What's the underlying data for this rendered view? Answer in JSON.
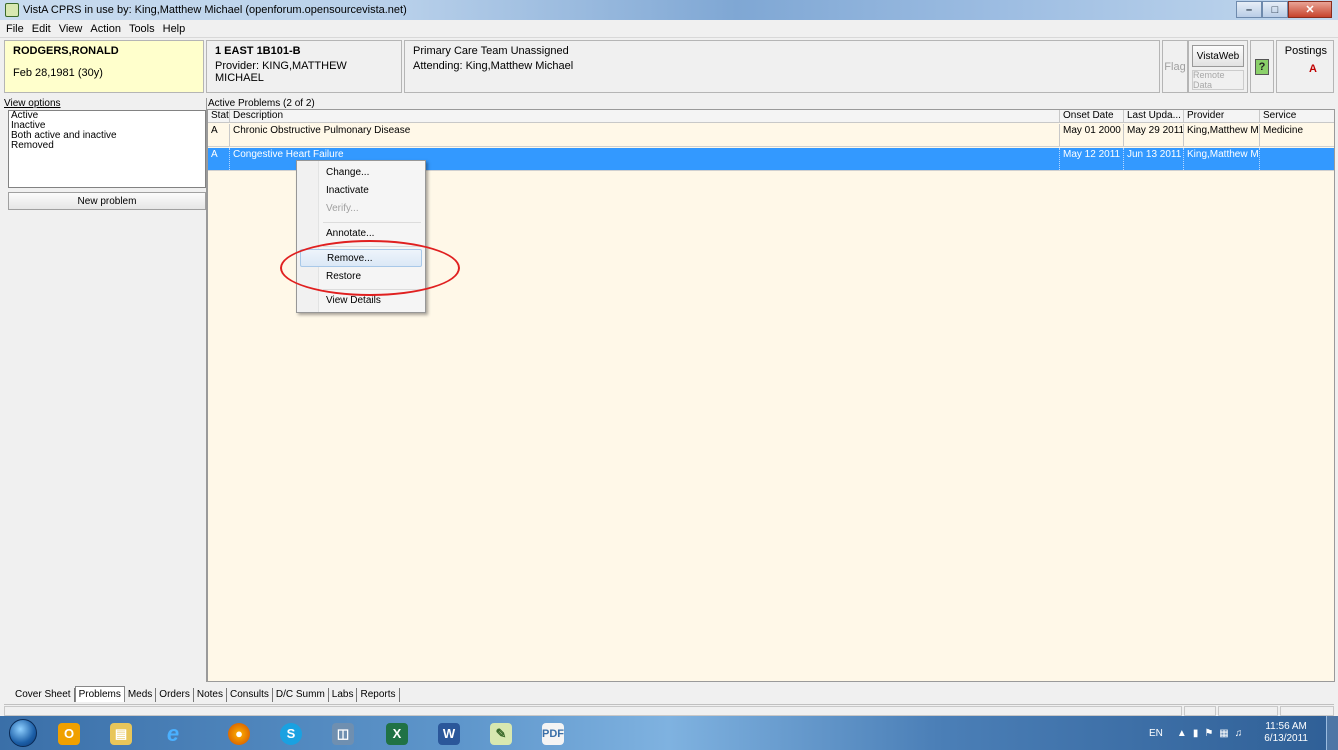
{
  "window": {
    "title": "VistA CPRS in use by: King,Matthew Michael  (openforum.opensourcevista.net)",
    "controls": [
      "minimize-icon",
      "maximize-icon",
      "close-icon"
    ]
  },
  "menu": [
    "File",
    "Edit",
    "View",
    "Action",
    "Tools",
    "Help"
  ],
  "patient": {
    "name": "RODGERS,RONALD",
    "dob": "Feb 28,1981  (30y)",
    "location": "1 EAST 1B101-B",
    "provider": "Provider:  KING,MATTHEW MICHAEL",
    "team": "Primary Care Team Unassigned",
    "attending": "Attending:  King,Matthew Michael"
  },
  "toolbar": {
    "flag": "Flag",
    "vistaweb": "VistaWeb",
    "remote_data": "Remote Data",
    "help_glyph": "?",
    "postings_label": "Postings",
    "postings_value": "A"
  },
  "view_options": {
    "caption": "View options",
    "items": [
      "Active",
      "Inactive",
      "Both active and inactive",
      "Removed"
    ],
    "new_problem": "New problem"
  },
  "problems": {
    "caption": "Active Problems  (2 of 2)",
    "columns": [
      "Stat...",
      "Description",
      "Onset Date",
      "Last Upda...",
      "Provider",
      "Service"
    ],
    "rows": [
      {
        "status": "A",
        "description": "Chronic Obstructive Pulmonary Disease",
        "onset": "May 01 2000",
        "last_updated": "May 29 2011",
        "provider": "King,Matthew Mich",
        "service": "Medicine"
      },
      {
        "status": "A",
        "description": "Congestive Heart Failure",
        "onset": "May 12 2011",
        "last_updated": "Jun 13 2011",
        "provider": "King,Matthew Mich",
        "service": ""
      }
    ]
  },
  "context_menu": {
    "items": [
      "Change...",
      "Inactivate",
      "Verify...",
      "Annotate...",
      "Remove...",
      "Restore",
      "View Details"
    ],
    "disabled": [
      "Verify..."
    ],
    "highlighted": "Remove..."
  },
  "tabs": [
    "Cover Sheet",
    "Problems",
    "Meds",
    "Orders",
    "Notes",
    "Consults",
    "D/C Summ",
    "Labs",
    "Reports"
  ],
  "active_tab": "Problems",
  "taskbar": {
    "apps": [
      "outlook-icon",
      "explorer-icon",
      "internet-explorer-icon",
      "firefox-icon",
      "skype-icon",
      "network-icon",
      "excel-icon",
      "word-icon",
      "cprs-icon",
      "pdf-icon"
    ],
    "language": "EN",
    "time": "11:56 AM",
    "date": "6/13/2011"
  },
  "colors": {
    "patient_bg": "#ffffcc",
    "grid_bg": "#fff8e8",
    "selection": "#3399ff",
    "annotation": "#e02020",
    "postings": "#c00000"
  }
}
